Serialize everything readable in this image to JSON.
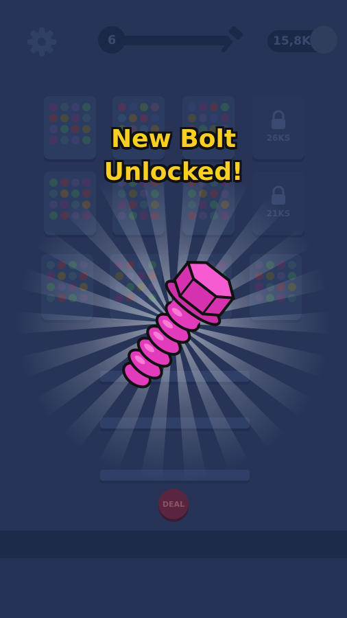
{
  "hud": {
    "level": "6",
    "coins": "15,8K",
    "settings_icon": "gear-icon",
    "hammer_icon": "hammer-icon",
    "coin_icon": "coin-icon"
  },
  "popup": {
    "title_line1": "New Bolt",
    "title_line2": "Unlocked!",
    "bolt_color": "#ee3ec0",
    "title_color": "#f9cf24"
  },
  "bolt_boxes": [
    {
      "locked": false,
      "colors": [
        "#5a3a6a",
        "#3a5a6a",
        "#4a4a7a",
        "#3a6a5a",
        "#6a3a4a",
        "#5a5a3a"
      ]
    },
    {
      "locked": false,
      "colors": [
        "#6a3a5a",
        "#3a4a7a",
        "#4a6a4a",
        "#5a4a6a",
        "#3a5a7a",
        "#6a5a3a"
      ]
    },
    {
      "locked": false,
      "colors": [
        "#3a4a7a",
        "#5a3a6a",
        "#6a3a4a",
        "#3a6a5a",
        "#5a5a3a",
        "#4a4a7a"
      ]
    },
    {
      "locked": true,
      "cost": "26KS"
    },
    {
      "locked": false,
      "colors": [
        "#3a6a5a",
        "#6a3a4a",
        "#4a4a7a",
        "#5a3a6a",
        "#3a5a6a",
        "#6a5a3a"
      ]
    },
    {
      "locked": false,
      "colors": [
        "#4a4a7a",
        "#3a6a5a",
        "#5a3a6a",
        "#6a3a4a",
        "#3a5a6a",
        "#5a5a3a"
      ]
    },
    {
      "locked": false,
      "colors": [
        "#6a3a4a",
        "#4a4a7a",
        "#3a5a6a",
        "#5a3a6a",
        "#3a6a5a",
        "#6a5a3a"
      ]
    },
    {
      "locked": true,
      "cost": "21KS"
    },
    {
      "locked": false,
      "colors": [
        "#3a5a6a",
        "#6a3a4a",
        "#3a6a5a",
        "#4a4a7a",
        "#5a3a6a",
        "#6a5a3a"
      ]
    },
    {
      "locked": false,
      "colors": [
        "#5a3a6a",
        "#6a3a4a",
        "#3a4a7a",
        "#3a6a5a",
        "#5a5a3a",
        "#4a4a7a"
      ]
    },
    {
      "locked": false,
      "colors": [
        "#3a5a6a",
        "#3a6a5a",
        "#4a4a7a",
        "#5a3a6a",
        "#6a3a4a",
        "#5a5a3a"
      ]
    },
    {
      "locked": false,
      "colors": [
        "#4a4a7a",
        "#3a6a5a",
        "#5a3a6a",
        "#3a5a6a",
        "#6a3a4a",
        "#5a5a3a"
      ]
    }
  ],
  "deal_button": "DEAL"
}
